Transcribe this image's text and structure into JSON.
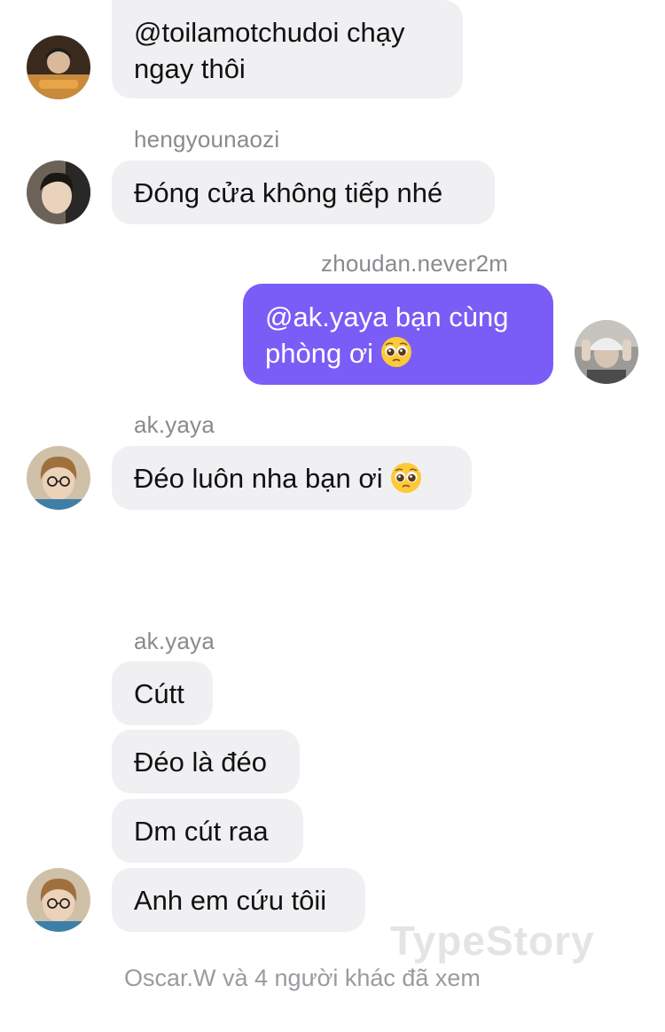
{
  "messages": {
    "m1": {
      "lines": [
        "@toilamotchudoi chạy",
        "ngay thôi"
      ]
    },
    "m2": {
      "sender": "hengyounaozi",
      "text": "Đóng cửa không tiếp nhé"
    },
    "m3": {
      "sender": "zhoudan.never2m",
      "lines": [
        "@ak.yaya bạn cùng",
        "phòng ơi"
      ],
      "emoji": "pleading-face"
    },
    "m4": {
      "sender": "ak.yaya",
      "text": "Đéo luôn nha bạn ơi",
      "emoji": "pleading-face"
    },
    "group": {
      "sender": "ak.yaya",
      "items": [
        "Cútt",
        "Đéo là đéo",
        "Dm cút raa",
        "Anh em cứu tôii"
      ]
    }
  },
  "watermark": "TypeStory",
  "seen_text": "Oscar.W và 4 người khác đã xem",
  "colors": {
    "own_bubble": "#7a5df6",
    "other_bubble": "#f0f0f3",
    "meta_text": "#8a8a8f"
  }
}
